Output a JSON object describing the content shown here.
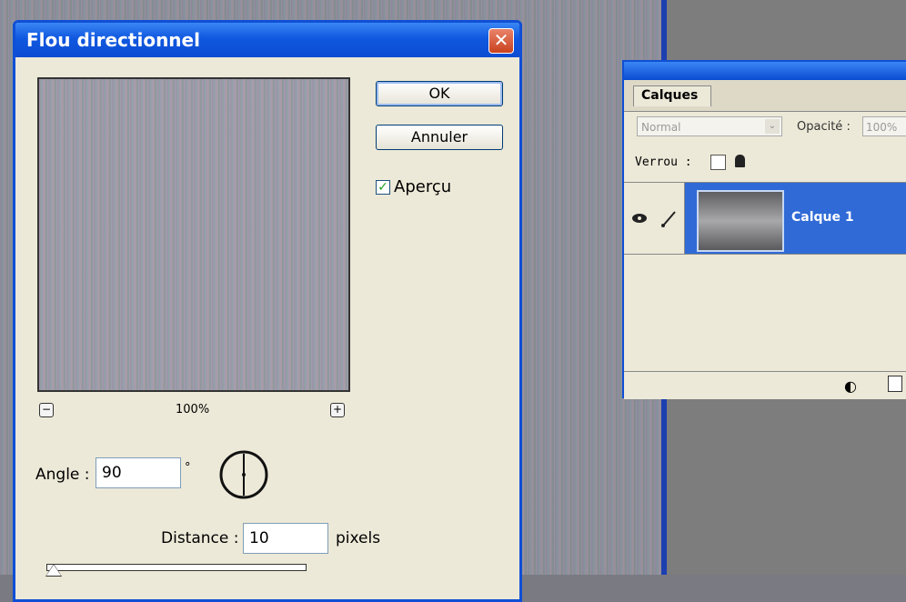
{
  "dialog": {
    "title": "Flou directionnel",
    "close_label": "✕",
    "ok_label": "OK",
    "cancel_label": "Annuler",
    "preview_checkbox": {
      "label": "Aperçu",
      "checked": true,
      "check_glyph": "✓"
    },
    "zoom": {
      "out_glyph": "−",
      "in_glyph": "+",
      "level": "100%"
    },
    "angle": {
      "label": "Angle :",
      "value": "90",
      "unit": "°"
    },
    "distance": {
      "label": "Distance :",
      "value": "10",
      "unit": "pixels"
    },
    "slider": {
      "value_fraction": 0.0
    }
  },
  "layers_panel": {
    "tab_label": "Calques",
    "blend_mode": "Normal",
    "blend_arrow": "⌄",
    "opacity_label": "Opacité :",
    "opacity_value": "100%",
    "lock_label": "Verrou :",
    "layers": [
      {
        "name": "Calque 1",
        "visible": true,
        "selected": true
      }
    ],
    "icons": [
      "eye-icon",
      "brush-icon",
      "adjustment-layer-icon",
      "new-layer-icon"
    ]
  },
  "colors": {
    "titlebar": "#0a4cd2",
    "selection": "#2f6ad6",
    "dialog_bg": "#ece9d8"
  }
}
